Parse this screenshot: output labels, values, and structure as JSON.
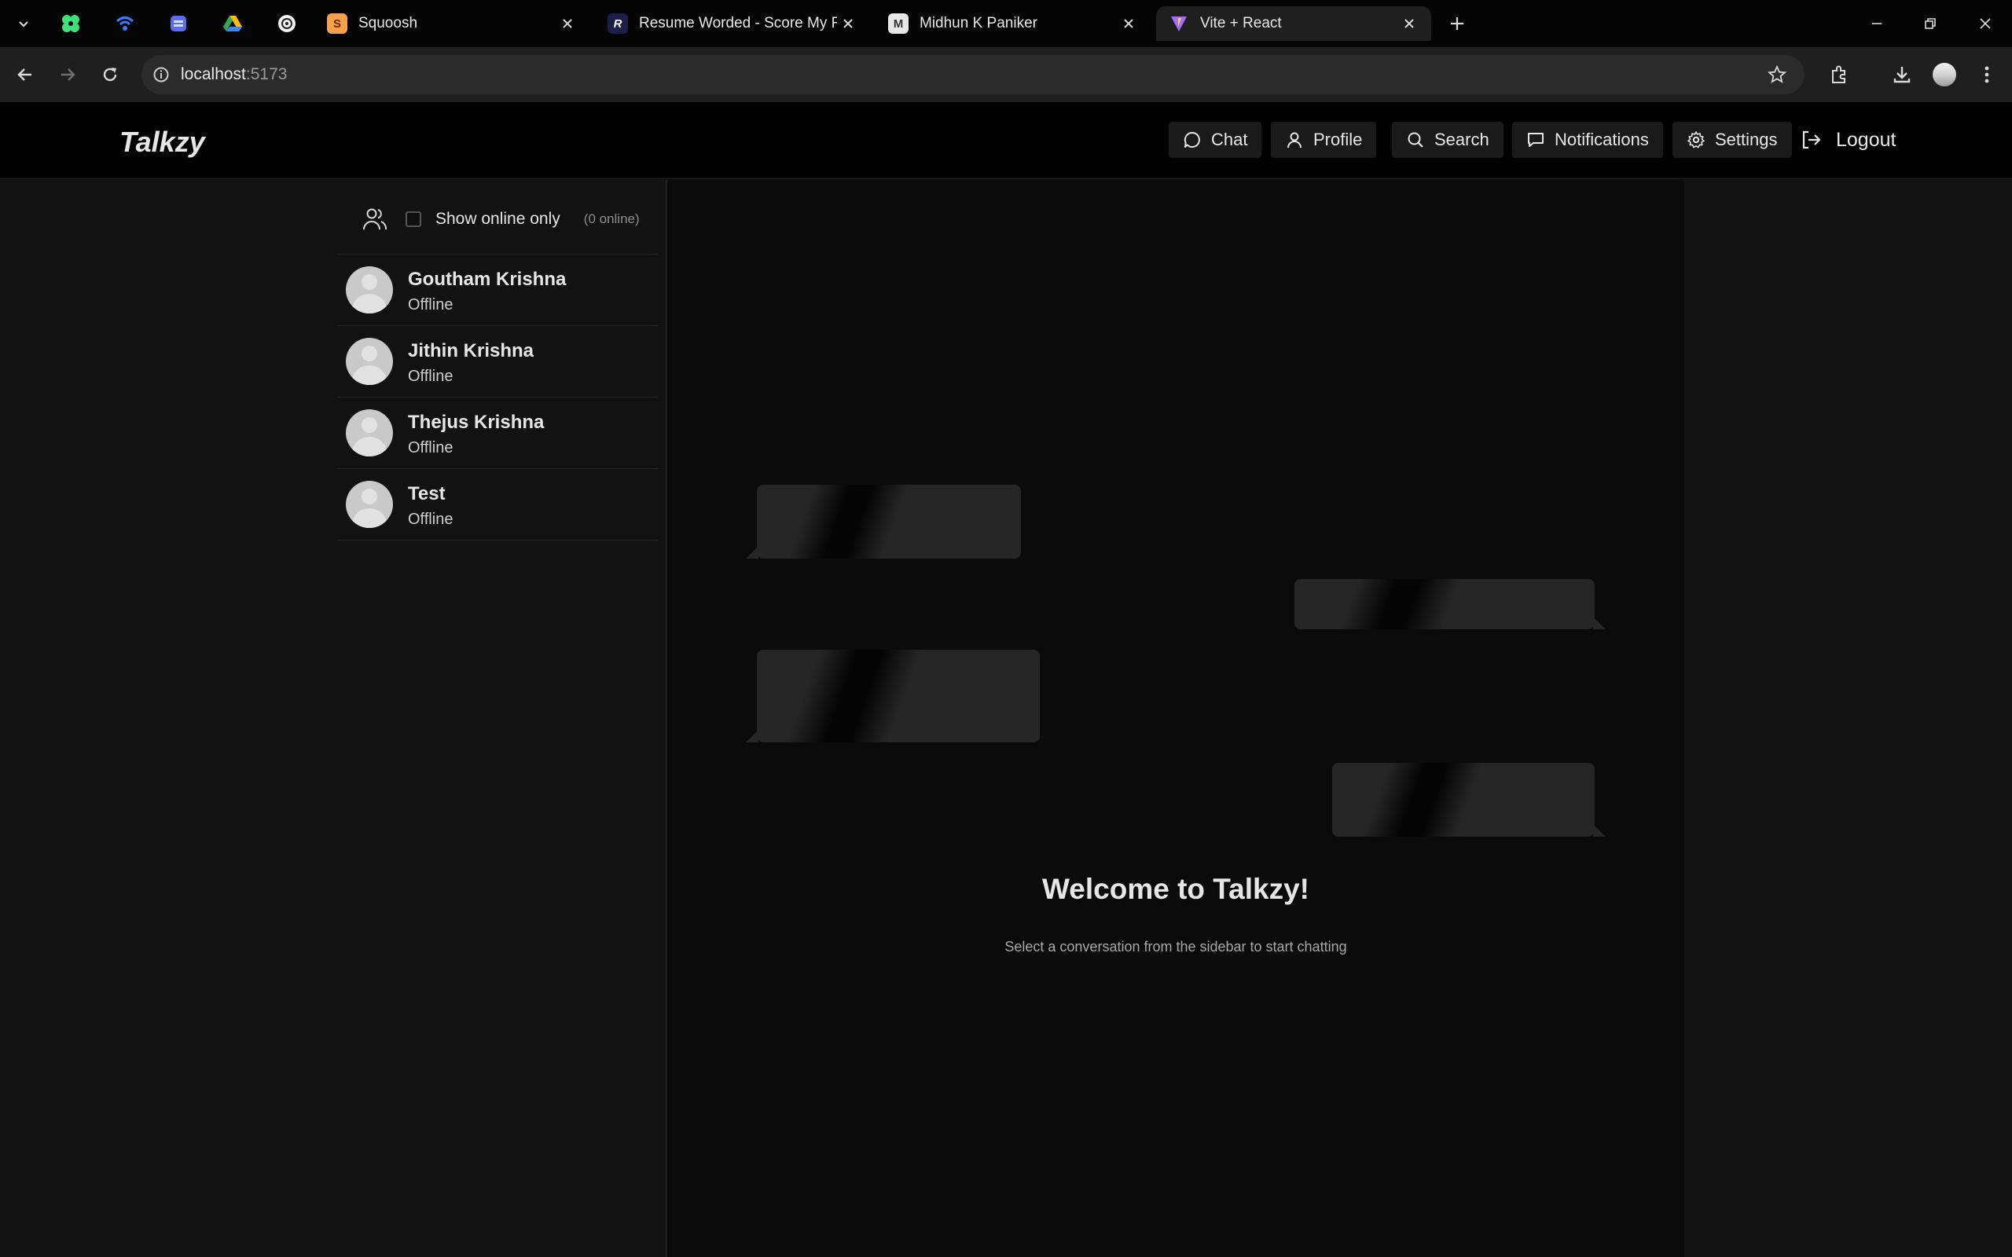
{
  "browser": {
    "tabs": [
      {
        "title": "Squoosh",
        "active": false
      },
      {
        "title": "Resume Worded - Score My Re",
        "active": false
      },
      {
        "title": "Midhun K Paniker",
        "active": false
      },
      {
        "title": "Vite + React",
        "active": true
      }
    ],
    "pinned_tabs": [
      "figma-icon",
      "wifi-icon",
      "docs-icon",
      "drive-icon",
      "chatgpt-icon"
    ],
    "url_host": "localhost",
    "url_port": ":5173"
  },
  "app": {
    "logo": "Talkzy",
    "nav": [
      {
        "label": "Chat",
        "icon": "chat-icon"
      },
      {
        "label": "Profile",
        "icon": "user-icon"
      },
      {
        "label": "Search",
        "icon": "search-icon"
      },
      {
        "label": "Notifications",
        "icon": "notification-icon"
      },
      {
        "label": "Settings",
        "icon": "gear-icon"
      }
    ],
    "logout_label": "Logout"
  },
  "sidebar": {
    "filter_label": "Show online only",
    "online_count": "(0 online)",
    "contacts": [
      {
        "name": "Goutham Krishna",
        "status": "Offline"
      },
      {
        "name": "Jithin Krishna",
        "status": "Offline"
      },
      {
        "name": "Thejus Krishna",
        "status": "Offline"
      },
      {
        "name": "Test",
        "status": "Offline"
      }
    ]
  },
  "chat": {
    "welcome_title": "Welcome to Talkzy!",
    "welcome_subtitle": "Select a conversation from the sidebar to start chatting"
  }
}
